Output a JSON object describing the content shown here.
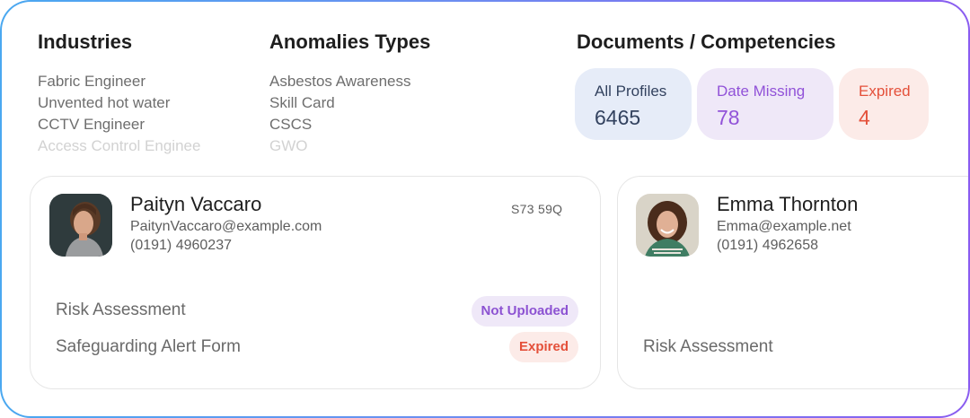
{
  "industries": {
    "title": "Industries",
    "items": [
      "Fabric Engineer",
      "Unvented hot water",
      "CCTV Engineer",
      "Access Control Enginee"
    ]
  },
  "anomalies": {
    "title": "Anomalies Types",
    "items": [
      "Asbestos Awareness",
      "Skill Card",
      "CSCS",
      "GWO"
    ]
  },
  "documents": {
    "title": "Documents / Competencies",
    "stats": [
      {
        "label": "All Profiles",
        "value": "6465"
      },
      {
        "label": "Date Missing",
        "value": "78"
      },
      {
        "label": "Expired",
        "value": "4"
      }
    ]
  },
  "profiles": [
    {
      "name": "Paityn Vaccaro",
      "email": "PaitynVaccaro@example.com",
      "phone": "(0191) 4960237",
      "postcode": "S73 59Q",
      "documents": [
        {
          "label": "Risk Assessment",
          "status": "Not Uploaded"
        },
        {
          "label": "Safeguarding Alert Form",
          "status": "Expired"
        }
      ]
    },
    {
      "name": "Emma Thornton",
      "email": "Emma@example.net",
      "phone": "(0191) 4962658",
      "documents": [
        {
          "label": "Risk Assessment"
        }
      ]
    }
  ],
  "colors": {
    "frame_gradient_start": "#4aa8f0",
    "frame_gradient_end": "#8a5cf0",
    "status_not_uploaded": "#8c52d2",
    "status_expired": "#e4503a"
  }
}
